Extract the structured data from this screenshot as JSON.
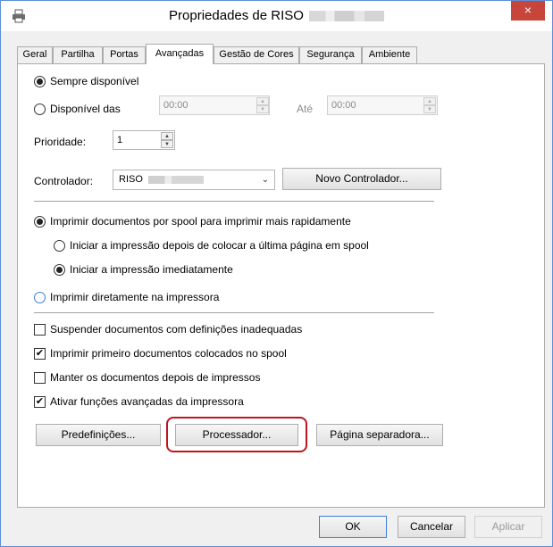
{
  "window": {
    "title": "Propriedades de RISO",
    "close_glyph": "×"
  },
  "tabs": [
    {
      "label": "Geral"
    },
    {
      "label": "Partilha"
    },
    {
      "label": "Portas"
    },
    {
      "label": "Avançadas",
      "active": true
    },
    {
      "label": "Gestão de Cores"
    },
    {
      "label": "Segurança"
    },
    {
      "label": "Ambiente"
    }
  ],
  "availability": {
    "always_label": "Sempre disponível",
    "from_label": "Disponível das",
    "from_time": "00:00",
    "until_label": "Até",
    "until_time": "00:00",
    "selected": "always"
  },
  "priority": {
    "label": "Prioridade:",
    "value": "1"
  },
  "driver": {
    "label": "Controlador:",
    "value": "RISO",
    "new_button": "Novo Controlador..."
  },
  "spool": {
    "spool_label": "Imprimir documentos por spool para imprimir mais rapidamente",
    "after_last_label": "Iniciar a impressão depois de colocar a última página em spool",
    "immediately_label": "Iniciar a impressão imediatamente",
    "direct_label": "Imprimir diretamente na impressora"
  },
  "options": [
    {
      "label": "Suspender documentos com definições inadequadas",
      "checked": false
    },
    {
      "label": "Imprimir primeiro documentos colocados no spool",
      "checked": true
    },
    {
      "label": "Manter os documentos depois de impressos",
      "checked": false
    },
    {
      "label": "Ativar funções avançadas da impressora",
      "checked": true
    }
  ],
  "buttons": {
    "defaults": "Predefinições...",
    "processor": "Processador...",
    "separator_page": "Página separadora...",
    "ok": "OK",
    "cancel": "Cancelar",
    "apply": "Aplicar"
  },
  "colors": {
    "highlight": "#c0151f",
    "close": "#c7453a",
    "accent": "#3c7fd5"
  },
  "glyphs": {
    "check": "✔",
    "spin_up": "▲",
    "spin_down": "▼",
    "combo_arrow": "⌄"
  }
}
